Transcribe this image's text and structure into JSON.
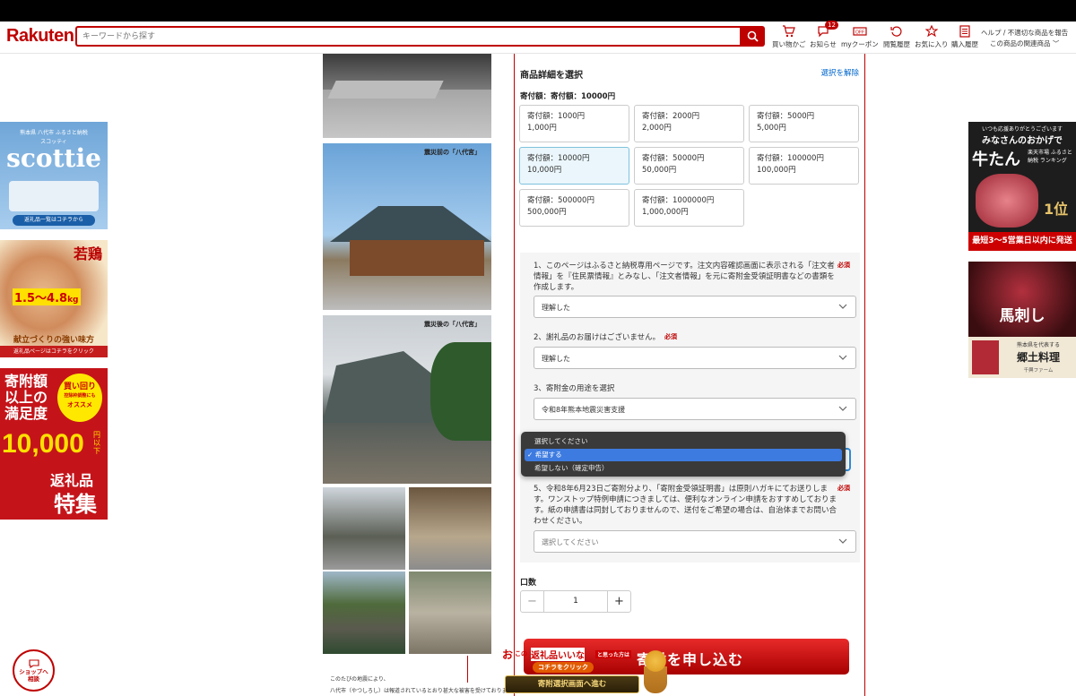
{
  "header": {
    "logo": "Rakuten",
    "search_placeholder": "キーワードから探す",
    "nav": [
      {
        "label": "買い物かご",
        "icon": "cart-icon"
      },
      {
        "label": "お知らせ",
        "icon": "bell-icon",
        "badge": "12"
      },
      {
        "label": "myクーポン",
        "icon": "coupon-icon"
      },
      {
        "label": "閲覧履歴",
        "icon": "history-icon"
      },
      {
        "label": "お気に入り",
        "icon": "star-icon"
      },
      {
        "label": "購入履歴",
        "icon": "receipt-icon"
      }
    ],
    "help_line1": "ヘルプ / 不適切な商品を報告",
    "help_line2": "この商品の関連商品 ﹀"
  },
  "banners": {
    "scottie": {
      "head": "熊本県 八代市 ふるさと納税",
      "sub": "スコッティ",
      "brand": "scottie",
      "cta": "返礼品一覧はコチラから"
    },
    "waka": {
      "title": "若鶏",
      "big": "1.5〜4.8",
      "unit": "kg",
      "line1": "献立づくりの強い味方",
      "cta": "返礼品ページはコチラをクリック"
    },
    "kifu": {
      "l1": "寄附額",
      "l2": "以上の",
      "l3": "満足度",
      "badge1": "買い回り",
      "badge2": "控除枠調整にも",
      "badge3": "オススメ",
      "amount": "10,000",
      "yen": "円以下",
      "l4": "返礼品",
      "l5": "特集"
    },
    "gyutan": {
      "top": "いつも応援ありがとうございます",
      "big": "みなさんのおかげで",
      "name": "牛たん",
      "rank": "楽天市場 ふるさと納税 ランキング",
      "pos": "1位",
      "ship": "最短3〜5営業日以内に発送"
    },
    "basashi": {
      "title": "馬刺し",
      "sub": "熊本県を代表する",
      "main": "郷土料理",
      "maker": "千興ファーム"
    }
  },
  "photos": {
    "before": "震災前の「八代宮」",
    "after": "震災後の「八代宮」",
    "foot1": "このたびの地震により、",
    "foot2": "八代市（やつしろし）は報道されているとおり甚大な被害を受けております。"
  },
  "panel": {
    "title": "商品詳細を選択",
    "clear": "選択を解除",
    "amount_label": "寄付額：",
    "amount_value": "寄付額：10000円",
    "options": [
      {
        "line1": "寄付額：1000円",
        "line2": "1,000円",
        "selected": false
      },
      {
        "line1": "寄付額：2000円",
        "line2": "2,000円",
        "selected": false
      },
      {
        "line1": "寄付額：5000円",
        "line2": "5,000円",
        "selected": false
      },
      {
        "line1": "寄付額：10000円",
        "line2": "10,000円",
        "selected": true
      },
      {
        "line1": "寄付額：50000円",
        "line2": "50,000円",
        "selected": false
      },
      {
        "line1": "寄付額：100000円",
        "line2": "100,000円",
        "selected": false
      },
      {
        "line1": "寄付額：500000円",
        "line2": "500,000円",
        "selected": false
      },
      {
        "line1": "寄付額：1000000円",
        "line2": "1,000,000円",
        "selected": false
      }
    ],
    "required": "必須",
    "q1": "1、このページはふるさと納税専用ページです。注文内容確認画面に表示される「注文者情報」を『住民票情報』とみなし、「注文者情報」を元に寄附金受領証明書などの書類を作成します。",
    "q1_value": "理解した",
    "q2": "2、謝礼品のお届けはございません。",
    "q2_value": "理解した",
    "q3": "3、寄附金の用途を選択",
    "q3_value": "令和8年熊本地震災害支援",
    "q4_options": [
      "選択してください",
      "希望する",
      "希望しない（確定申告）"
    ],
    "q4_checked": "✓",
    "q5": "5、令和8年6月23日ご寄附分より、「寄附金受領証明書」は原則ハガキにてお送りします。ワンストップ特例申請につきましては、便利なオンライン申請をおすすめしております。紙の申請書は同封しておりませんので、送付をご希望の場合は、自治体までお問い合わせください。",
    "q5_value": "選択してください",
    "qty_label": "口数",
    "qty_value": "1",
    "qty_minus": "−",
    "qty_plus": "+",
    "apply": "寄付を申し込む"
  },
  "promo": {
    "top1": "お",
    "top2": "この",
    "top3": "返礼品いいな",
    "top4": "と思った方は",
    "top5": "コチラをクリック",
    "bottom": "寄附選択画面へ進む"
  },
  "chat": {
    "line1": "ショップへ",
    "line2": "相談"
  },
  "colors": {
    "brand": "#bf0000",
    "link": "#0066cc",
    "selected_bg": "#eaf6fb",
    "dropdown_bg": "#3a3a3a",
    "dropdown_active": "#3d7be0"
  }
}
